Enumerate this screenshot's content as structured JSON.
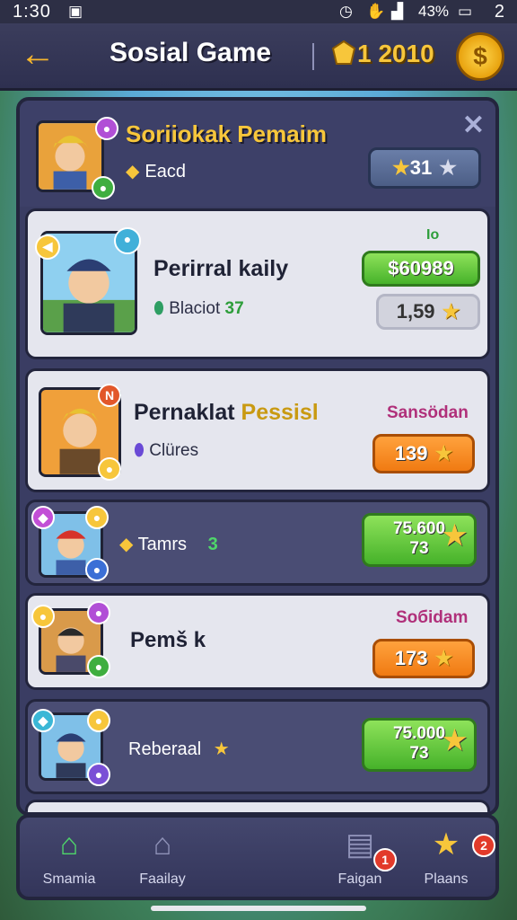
{
  "status_bar": {
    "time": "1:30",
    "battery": "43%",
    "notification_count": "2"
  },
  "header": {
    "title": "Sosial Game",
    "coins": "1 2010"
  },
  "top_section": {
    "title": "Soriiokak Pemaim",
    "subtitle": "Eacd",
    "score": "31"
  },
  "rows": [
    {
      "name": "Perirral kaily",
      "meta": "Blaciot",
      "meta_extra": "37",
      "tag": "Io",
      "price": "$60989",
      "secondary": "1,59"
    },
    {
      "name_part1": "Pernaklat",
      "name_part2": "Pessisl",
      "meta": "Clüres",
      "tag": "Sansödan",
      "price": "139"
    },
    {
      "name": "Tamrs",
      "meta_extra": "3",
      "price_line1": "75.600",
      "price_line2": "73"
    },
    {
      "name": "Pemš k",
      "tag": "Soбidam",
      "price": "173"
    },
    {
      "name": "Reberaal",
      "price_line1": "75.000",
      "price_line2": "73"
    }
  ],
  "bottom_nav": [
    {
      "label": "Smamia",
      "icon": "home-icon"
    },
    {
      "label": "Faailay",
      "icon": "house-icon"
    },
    {
      "label": "Faigan",
      "icon": "trophy-icon",
      "badge": "1"
    },
    {
      "label": "Plaans",
      "icon": "star-icon",
      "badge": "2"
    }
  ],
  "colors": {
    "accent_gold": "#f7c63b",
    "panel": "#3a3d63",
    "green": "#46b22a",
    "orange": "#f07a12"
  }
}
